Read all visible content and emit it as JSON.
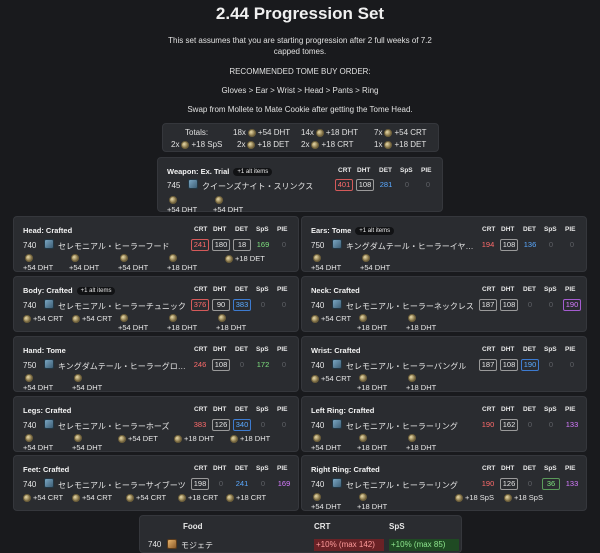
{
  "title": "2.44 Progression Set",
  "intro": {
    "line1": "This set assumes that you are starting progression after 2 full weeks of 7.2",
    "line2": "capped tomes.",
    "order_heading": "RECOMMENDED TOME BUY ORDER:",
    "order": "Gloves > Ear > Wrist > Head > Pants > Ring",
    "swap": "Swap from Mollete to Mate Cookie after getting the Tome Head."
  },
  "stat_headers": [
    "CRT",
    "DHT",
    "DET",
    "SpS",
    "PIE"
  ],
  "totals": {
    "label": "Totals:",
    "items": [
      {
        "count": "18x",
        "text": "+54 DHT"
      },
      {
        "count": "14x",
        "text": "+18 DHT"
      },
      {
        "count": "7x",
        "text": "+54 CRT"
      },
      {
        "count": "2x",
        "text": "+18 SpS"
      },
      {
        "count": "2x",
        "text": "+18 DET"
      },
      {
        "count": "2x",
        "text": "+18 CRT"
      },
      {
        "count": "1x",
        "text": "+18 DET"
      }
    ]
  },
  "weapon": {
    "title": "Weapon: Ex. Trial",
    "alt": "+1 alt items",
    "ilvl": "745",
    "name": "クイーンズナイト・スリンクス",
    "stats": [
      "401",
      "108",
      "281",
      "0",
      "0"
    ],
    "materia": [
      "+54 DHT",
      "+54 DHT"
    ]
  },
  "left_panels": [
    {
      "title": "Head: Crafted",
      "alt": "",
      "ilvl": "740",
      "name": "セレモニアル・ヒーラーフード",
      "stats": [
        "241",
        "180",
        "18",
        "169",
        "0"
      ],
      "materia": [
        "+54 DHT",
        "+54 DHT",
        "+54 DHT",
        "+18 DHT",
        "+18 DET"
      ]
    },
    {
      "title": "Body: Crafted",
      "alt": "+1 alt items",
      "ilvl": "740",
      "name": "セレモニアル・ヒーラーチュニック",
      "stats": [
        "376",
        "90",
        "383",
        "0",
        "0"
      ],
      "materia": [
        "+54 CRT",
        "+54 CRT",
        "+54 DHT",
        "+18 DHT",
        "+18 DHT"
      ]
    },
    {
      "title": "Hand: Tome",
      "alt": "",
      "ilvl": "750",
      "name": "キングダムテール・ヒーラーグロ…",
      "stats": [
        "246",
        "108",
        "0",
        "172",
        "0"
      ],
      "materia": [
        "+54 DHT",
        "+54 DHT"
      ]
    },
    {
      "title": "Legs: Crafted",
      "alt": "",
      "ilvl": "740",
      "name": "セレモニアル・ヒーラーホーズ",
      "stats": [
        "383",
        "126",
        "340",
        "0",
        "0"
      ],
      "materia": [
        "+54 DHT",
        "+54 DHT",
        "+54 DET",
        "+18 DHT",
        "+18 DHT"
      ]
    },
    {
      "title": "Feet: Crafted",
      "alt": "",
      "ilvl": "740",
      "name": "セレモニアル・ヒーラーサイブーツ",
      "stats": [
        "198",
        "0",
        "241",
        "0",
        "169"
      ],
      "materia": [
        "+54 CRT",
        "+54 CRT",
        "+54 CRT",
        "+18 CRT",
        "+18 CRT"
      ]
    }
  ],
  "right_panels": [
    {
      "title": "Ears: Tome",
      "alt": "+1 alt items",
      "ilvl": "750",
      "name": "キングダムテール・ヒーラーイヤ…",
      "stats": [
        "194",
        "108",
        "136",
        "0",
        "0"
      ],
      "materia": [
        "+54 DHT",
        "+54 DHT"
      ]
    },
    {
      "title": "Neck: Crafted",
      "alt": "",
      "ilvl": "740",
      "name": "セレモニアル・ヒーラーネックレス",
      "stats": [
        "187",
        "108",
        "0",
        "0",
        "190"
      ],
      "materia": [
        "+54 CRT",
        "+18 DHT",
        "+18 DHT"
      ]
    },
    {
      "title": "Wrist: Crafted",
      "alt": "",
      "ilvl": "740",
      "name": "セレモニアル・ヒーラーバングル",
      "stats": [
        "187",
        "108",
        "190",
        "0",
        "0"
      ],
      "materia": [
        "+54 CRT",
        "+18 DHT",
        "+18 DHT"
      ]
    },
    {
      "title": "Left Ring: Crafted",
      "alt": "",
      "ilvl": "740",
      "name": "セレモニアル・ヒーラーリング",
      "stats": [
        "190",
        "162",
        "0",
        "0",
        "133"
      ],
      "materia": [
        "+54 DHT",
        "+18 DHT",
        "+18 DHT"
      ]
    },
    {
      "title": "Right Ring: Crafted",
      "alt": "",
      "ilvl": "740",
      "name": "セレモニアル・ヒーラーリング",
      "stats": [
        "190",
        "126",
        "0",
        "36",
        "133"
      ],
      "materia": [
        "+54 DHT",
        "+18 DHT",
        "+18 SpS",
        "+18 SpS"
      ]
    }
  ],
  "food": {
    "header": "Food",
    "crt_header": "CRT",
    "sps_header": "SpS",
    "ilvl": "740",
    "name": "モジェテ",
    "crt": "+10% (max 142)",
    "sps": "+10% (max 85)"
  }
}
